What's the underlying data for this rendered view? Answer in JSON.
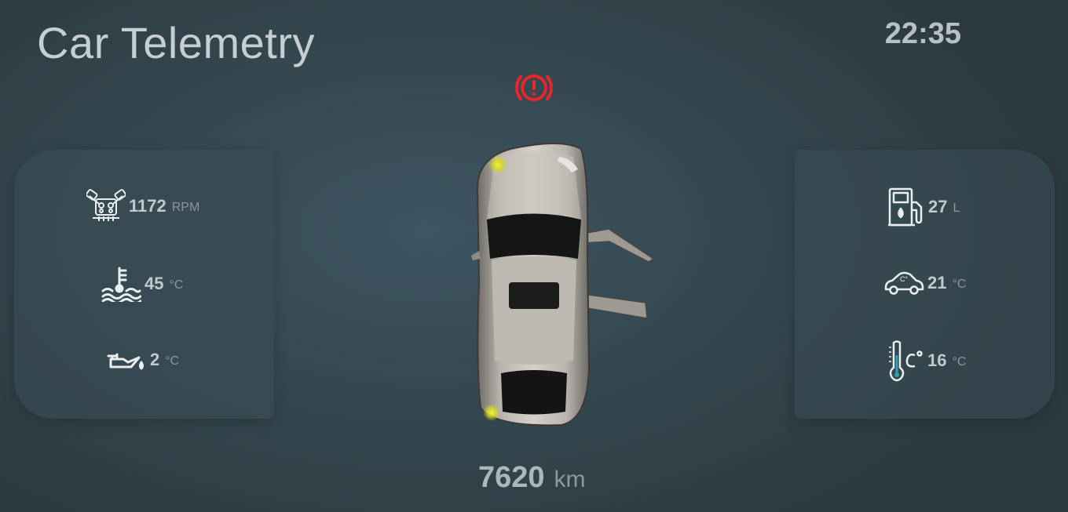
{
  "app": {
    "title": "Car Telemetry",
    "time": "22:35"
  },
  "warning": {
    "icon": "brake-warning-icon",
    "color": "#e8262b"
  },
  "left_panel": {
    "rpm": {
      "icon": "engine-icon",
      "value": "1172",
      "unit": "RPM"
    },
    "coolant": {
      "icon": "coolant-temperature-icon",
      "value": "45",
      "unit": "°C"
    },
    "oil": {
      "icon": "oil-can-icon",
      "value": "2",
      "unit": "°C"
    }
  },
  "right_panel": {
    "fuel": {
      "icon": "fuel-pump-icon",
      "value": "27",
      "unit": "L"
    },
    "cabin": {
      "icon": "car-temperature-icon",
      "value": "21",
      "unit": "°C"
    },
    "outside": {
      "icon": "thermometer-icon",
      "value": "16",
      "unit": "°C"
    }
  },
  "odometer": {
    "value": "7620",
    "unit": "km"
  },
  "car": {
    "icon": "car-top-view",
    "doors_open": [
      "front-right",
      "rear-right"
    ],
    "indicators": [
      "front-left",
      "rear-left"
    ],
    "indicator_color": "#e4e82a"
  }
}
